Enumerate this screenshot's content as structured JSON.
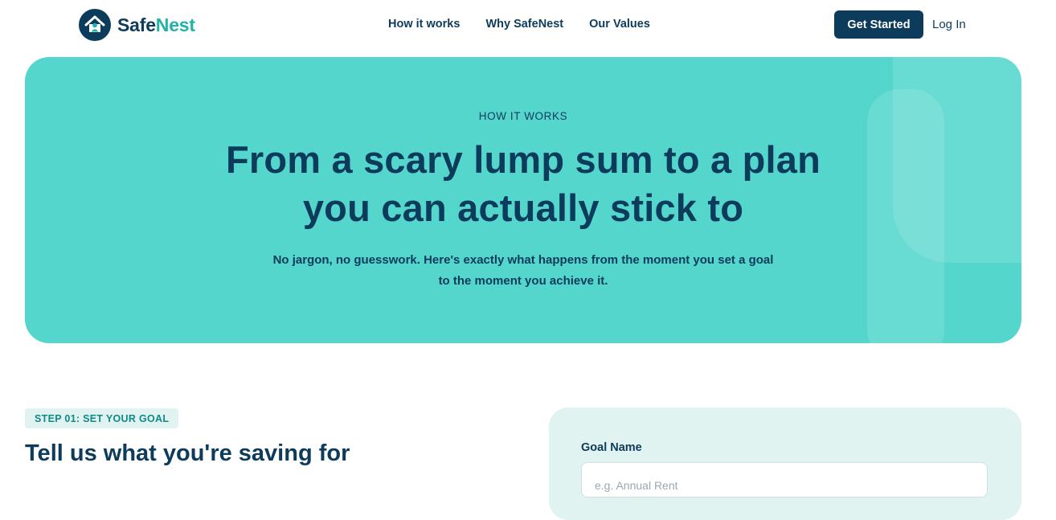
{
  "brand": {
    "name_part1": "Safe",
    "name_part2": "Nest",
    "colors": {
      "primary": "#0d3b5c",
      "accent": "#1fb3a8",
      "hero_bg": "#54d6cc",
      "card_bg": "#e0f3f1"
    }
  },
  "nav": {
    "items": [
      {
        "label": "How it works"
      },
      {
        "label": "Why SafeNest"
      },
      {
        "label": "Our Values"
      }
    ],
    "cta_label": "Get Started",
    "login_label": "Log In"
  },
  "hero": {
    "eyebrow": "HOW IT WORKS",
    "title_line1": "From a scary lump sum to a plan",
    "title_line2": "you can actually stick to",
    "subtitle_line1": "No jargon, no guesswork. Here's exactly what happens from the moment you set a goal",
    "subtitle_line2": "to the moment you achieve it."
  },
  "step": {
    "badge": "STEP 01: SET YOUR GOAL",
    "title": "Tell us what you're saving for"
  },
  "form": {
    "goal_name_label": "Goal Name",
    "goal_name_placeholder": "e.g. Annual Rent",
    "goal_name_value": ""
  },
  "icons": [
    "house-logo-icon"
  ]
}
